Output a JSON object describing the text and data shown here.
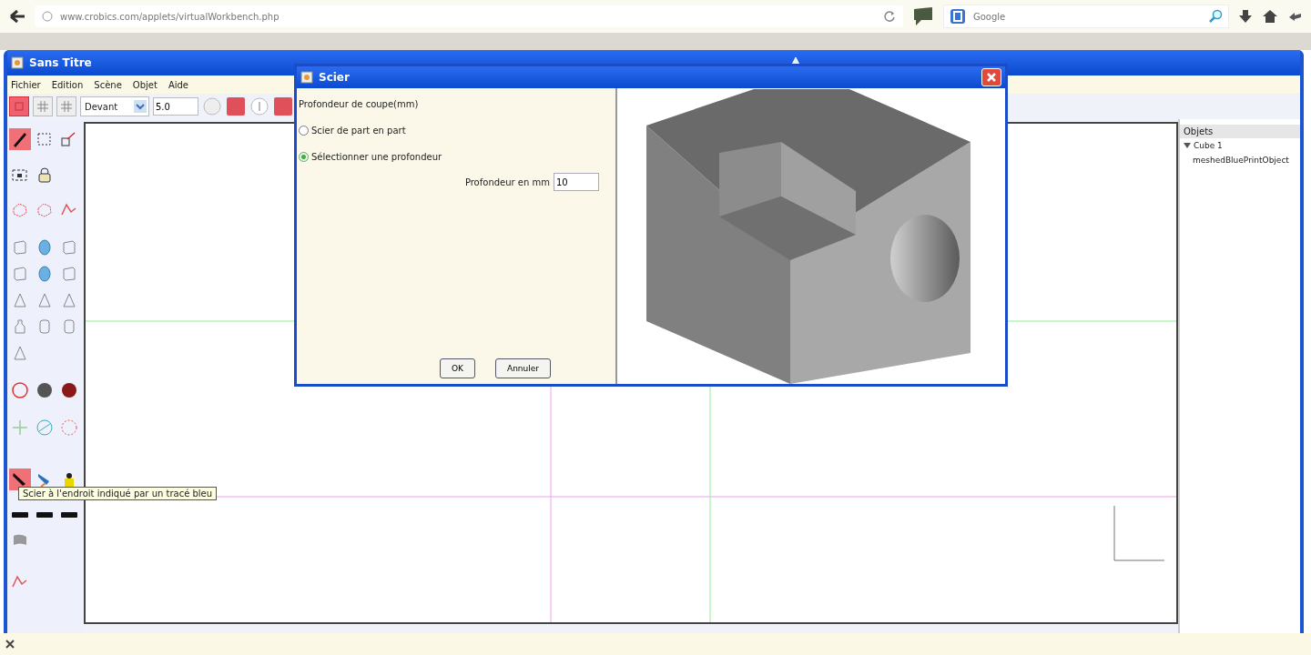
{
  "browser": {
    "url": "www.crobics.com/applets/virtualWorkbench.php",
    "search_placeholder": "Google"
  },
  "window": {
    "title": "Sans Titre"
  },
  "menu": [
    "Fichier",
    "Edition",
    "Scène",
    "Objet",
    "Aide"
  ],
  "toolbar": {
    "view_modes": [
      {
        "selected": true
      },
      {
        "selected": false
      },
      {
        "selected": false
      }
    ],
    "view": "Devant",
    "zoom": "5.0"
  },
  "palette": [
    [
      {
        "kind": "pencil",
        "selected": true
      },
      {
        "kind": "selection",
        "selected": false
      },
      {
        "kind": "scale",
        "selected": false
      }
    ],
    [
      {
        "kind": "group",
        "selected": false
      },
      {
        "kind": "lock",
        "selected": false
      }
    ],
    [
      {
        "kind": "shape",
        "selected": false
      },
      {
        "kind": "shape",
        "selected": false
      },
      {
        "kind": "polyline",
        "selected": false
      }
    ],
    [
      {
        "kind": "cube",
        "selected": false
      },
      {
        "kind": "sphere",
        "selected": false
      },
      {
        "kind": "cube",
        "selected": false
      }
    ],
    [
      {
        "kind": "cube",
        "selected": false
      },
      {
        "kind": "sphere",
        "selected": false
      },
      {
        "kind": "cube",
        "selected": false
      }
    ],
    [
      {
        "kind": "cone",
        "selected": false
      },
      {
        "kind": "cone",
        "selected": false
      },
      {
        "kind": "cone",
        "selected": false
      }
    ],
    [
      {
        "kind": "bottle",
        "selected": false
      },
      {
        "kind": "cylinder",
        "selected": false
      },
      {
        "kind": "cylinder",
        "selected": false
      }
    ],
    [
      {
        "kind": "cone",
        "selected": false
      }
    ],
    [
      {
        "kind": "ring",
        "selected": false
      },
      {
        "kind": "disc",
        "selected": false
      },
      {
        "kind": "disc",
        "selected": false
      }
    ],
    [
      {
        "kind": "crosshair",
        "selected": false
      },
      {
        "kind": "circle",
        "selected": false
      },
      {
        "kind": "dotted",
        "selected": false
      }
    ],
    [
      {
        "kind": "saw",
        "selected": true
      },
      {
        "kind": "brush",
        "selected": false
      },
      {
        "kind": "bucket",
        "selected": false
      }
    ],
    [
      {
        "kind": "bar",
        "selected": false
      },
      {
        "kind": "bar",
        "selected": false
      },
      {
        "kind": "bar",
        "selected": false
      }
    ],
    [
      {
        "kind": "flag",
        "selected": false
      }
    ],
    [
      {
        "kind": "polyline",
        "selected": false
      }
    ]
  ],
  "tooltip": "Scier à l'endroit indiqué par un tracé bleu",
  "objects": {
    "title": "Objets",
    "tree": [
      {
        "label": "Cube 1",
        "expanded": true,
        "children": [
          {
            "label": "meshedBluePrintObject"
          }
        ]
      }
    ]
  },
  "dialog": {
    "title": "Scier",
    "heading": "Profondeur de coupe(mm)",
    "options": [
      {
        "label": "Scier de part en part",
        "selected": false
      },
      {
        "label": "Sélectionner une profondeur",
        "selected": true
      }
    ],
    "depth_label": "Profondeur en mm",
    "depth_value": "10",
    "buttons": [
      "OK",
      "Annuler"
    ]
  }
}
